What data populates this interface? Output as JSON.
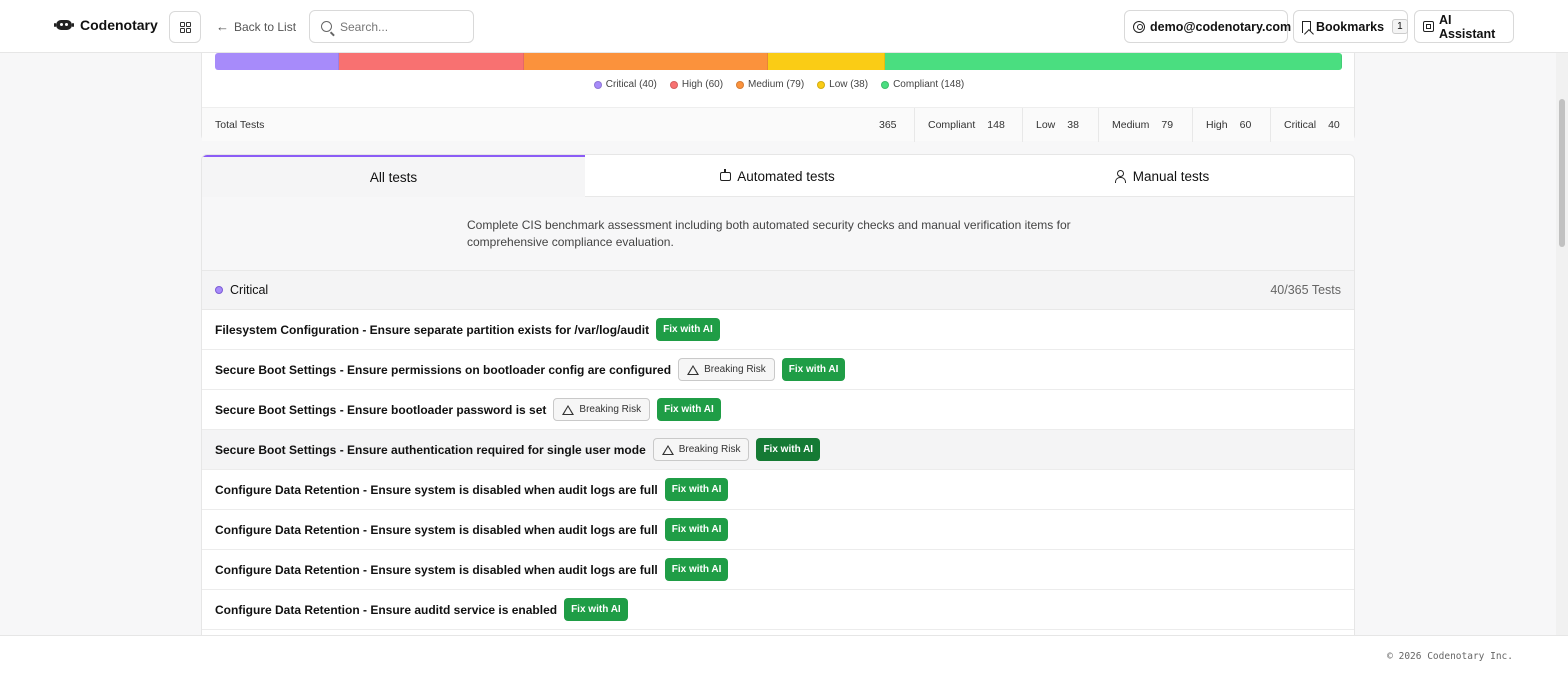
{
  "header": {
    "brand": "Codenotary",
    "back_label": "Back to List",
    "search_placeholder": "Search...",
    "user_email": "demo@codenotary.com",
    "bookmarks_label": "Bookmarks",
    "bookmarks_count": "1",
    "ai_label": "AI Assistant"
  },
  "summary": {
    "segments": [
      {
        "name": "Critical",
        "value": 40,
        "color": "#a78bfa"
      },
      {
        "name": "High",
        "value": 60,
        "color": "#f87171"
      },
      {
        "name": "Medium",
        "value": 79,
        "color": "#fb923c"
      },
      {
        "name": "Low",
        "value": 38,
        "color": "#facc15"
      },
      {
        "name": "Compliant",
        "value": 148,
        "color": "#4ade80"
      }
    ],
    "legend": [
      "Critical (40)",
      "High (60)",
      "Medium (79)",
      "Low (38)",
      "Compliant (148)"
    ],
    "total_label": "Total Tests",
    "total_value": "365",
    "cells": [
      {
        "label": "Compliant",
        "value": "148"
      },
      {
        "label": "Low",
        "value": "38"
      },
      {
        "label": "Medium",
        "value": "79"
      },
      {
        "label": "High",
        "value": "60"
      },
      {
        "label": "Critical",
        "value": "40"
      }
    ]
  },
  "tabs": [
    "All tests",
    "Automated tests",
    "Manual tests"
  ],
  "description": "Complete CIS benchmark assessment including both automated security checks and manual verification items for comprehensive compliance evaluation.",
  "group": {
    "label": "Critical",
    "count": "40/365 Tests",
    "color": "#a78bfa"
  },
  "risk_label": "Breaking Risk",
  "fix_label": "Fix with AI",
  "rows": [
    {
      "title": "Filesystem Configuration - Ensure separate partition exists for /var/log/audit",
      "risk": false
    },
    {
      "title": "Secure Boot Settings - Ensure permissions on bootloader config are configured",
      "risk": true
    },
    {
      "title": "Secure Boot Settings - Ensure bootloader password is set",
      "risk": true
    },
    {
      "title": "Secure Boot Settings - Ensure authentication required for single user mode",
      "risk": true
    },
    {
      "title": "Configure Data Retention - Ensure system is disabled when audit logs are full",
      "risk": false
    },
    {
      "title": "Configure Data Retention - Ensure system is disabled when audit logs are full",
      "risk": false
    },
    {
      "title": "Configure Data Retention - Ensure system is disabled when audit logs are full",
      "risk": false
    },
    {
      "title": "Configure Data Retention - Ensure auditd service is enabled",
      "risk": false
    }
  ],
  "footer": "© 2026 Codenotary Inc."
}
